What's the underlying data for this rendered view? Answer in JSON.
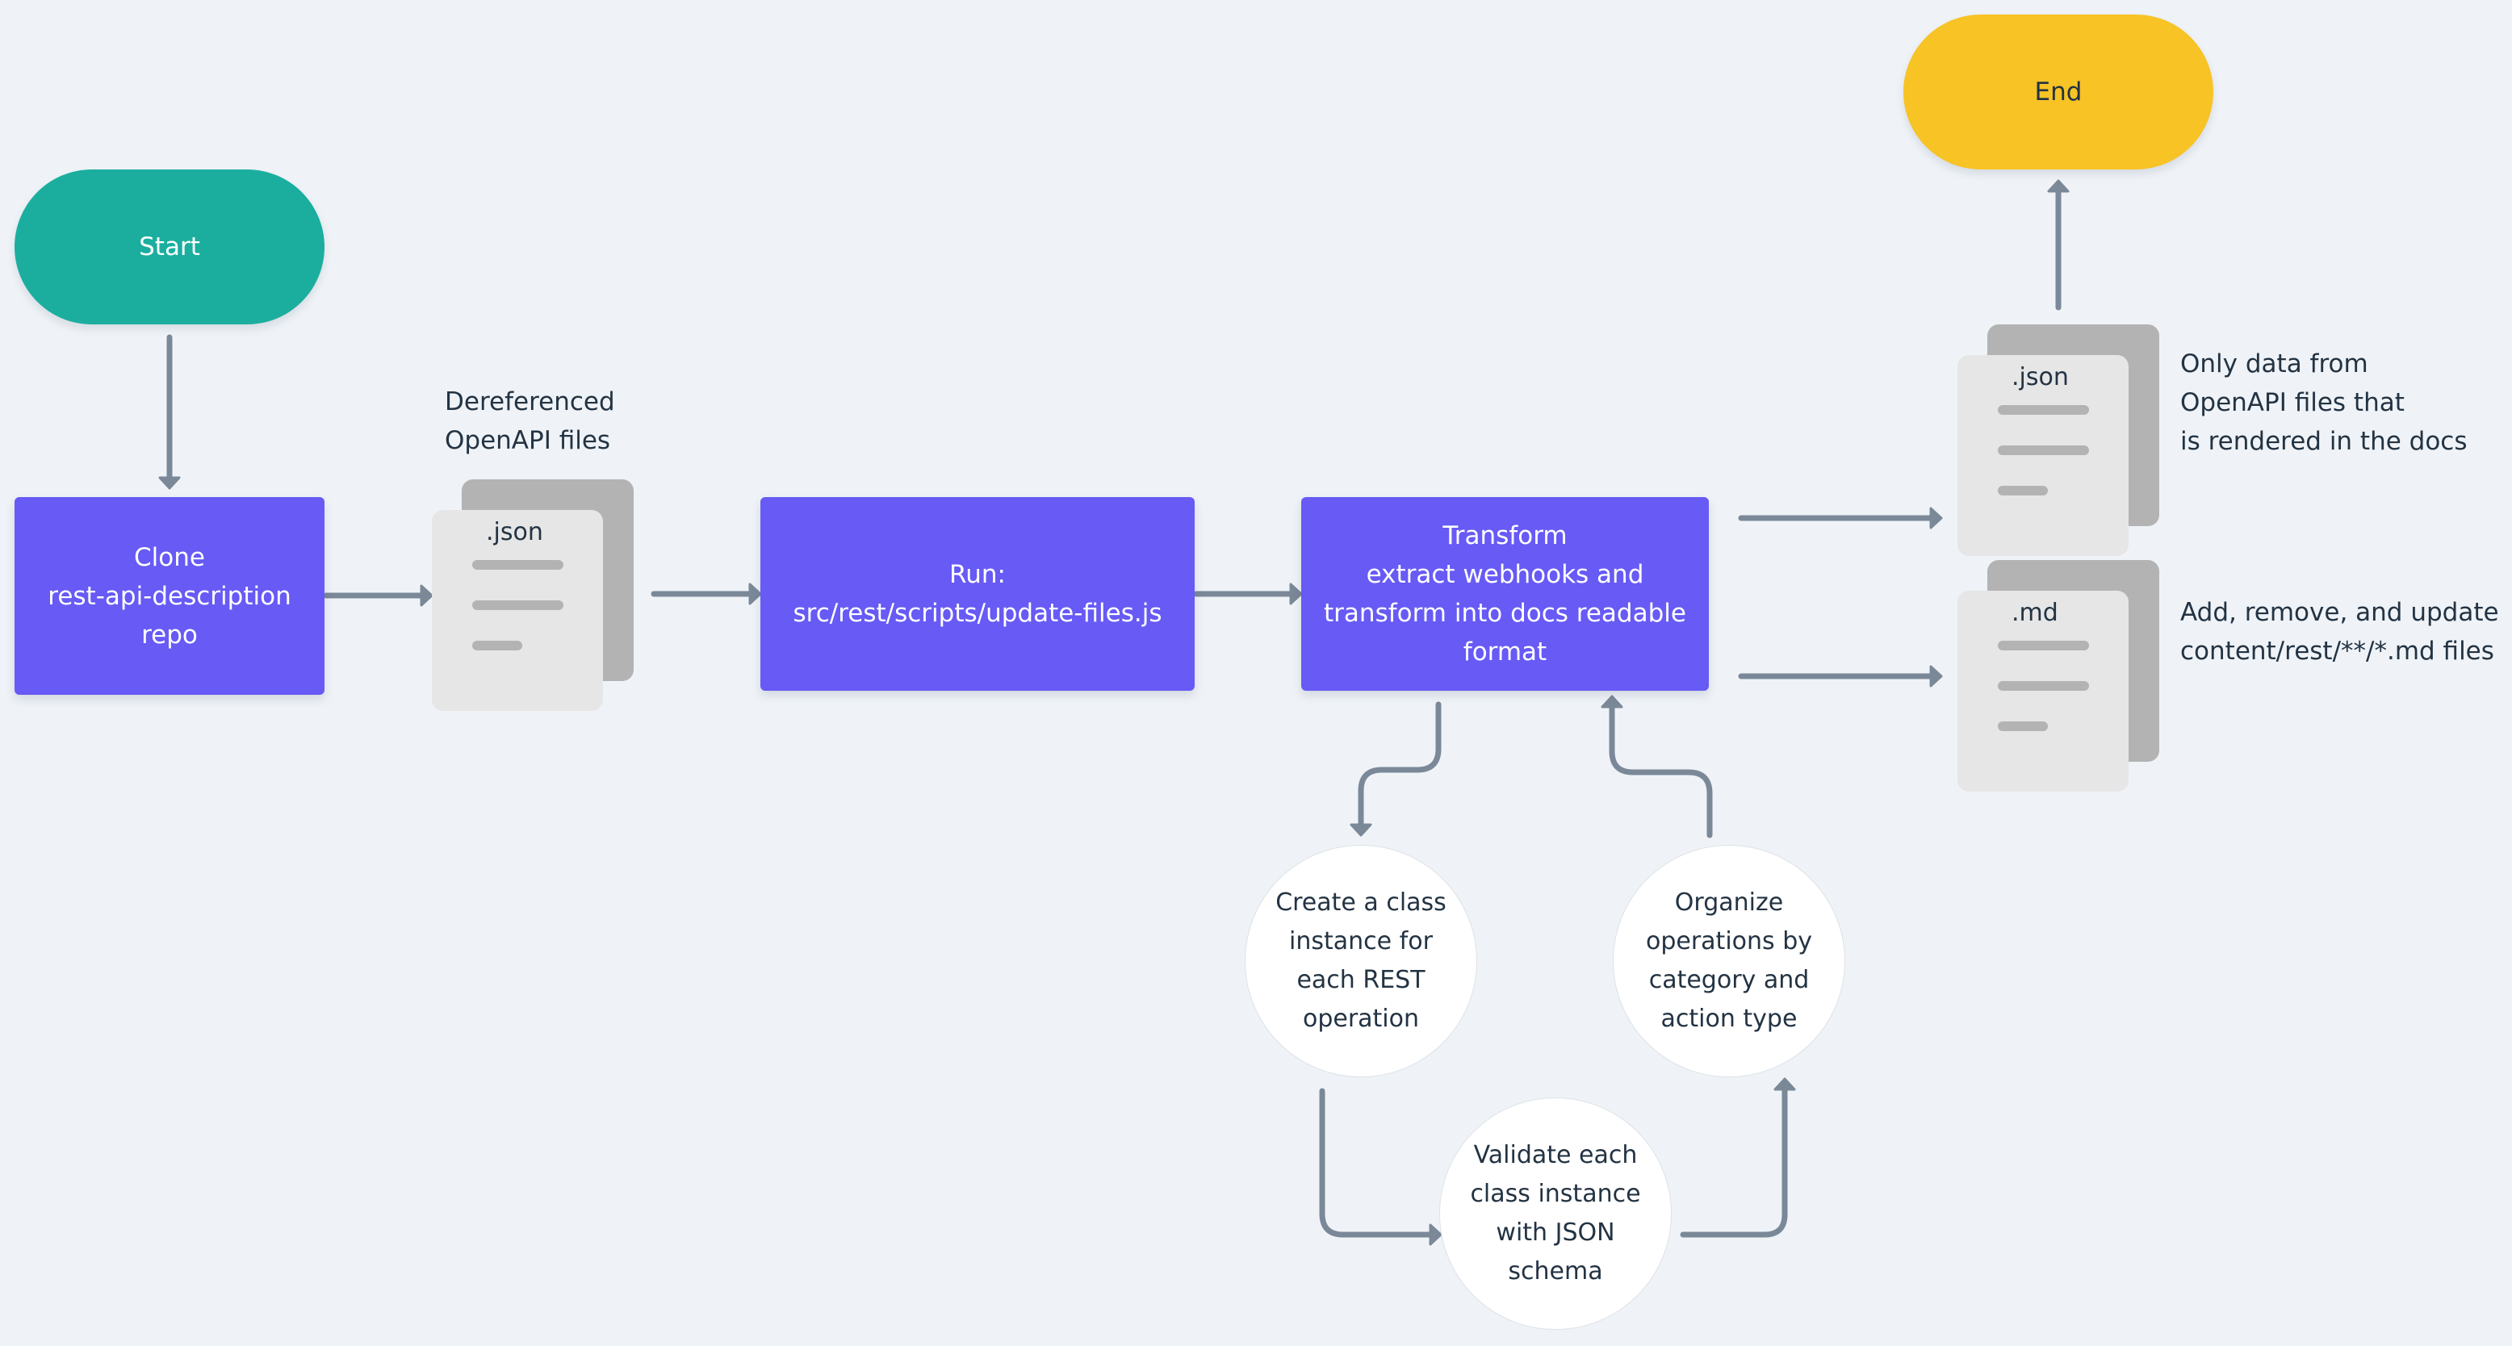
{
  "diagram": {
    "nodes": {
      "start": {
        "label": "Start",
        "shape": "terminal",
        "color": "#1bae9f"
      },
      "end": {
        "label": "End",
        "shape": "terminal",
        "color": "#f7c325"
      },
      "clone": {
        "label": "Clone\nrest-api-description\nrepo",
        "shape": "process",
        "color": "#675af5"
      },
      "run": {
        "label": "Run:\nsrc/rest/scripts/update-files.js",
        "shape": "process",
        "color": "#675af5"
      },
      "transform": {
        "label": "Transform\nextract webhooks and\ntransform into docs readable\nformat",
        "shape": "process",
        "color": "#675af5"
      },
      "create": {
        "label": "Create a class\ninstance for\neach REST\noperation",
        "shape": "circle"
      },
      "validate": {
        "label": "Validate each\nclass instance\nwith JSON\nschema",
        "shape": "circle"
      },
      "organize": {
        "label": "Organize\noperations by\ncategory and\naction type",
        "shape": "circle"
      }
    },
    "documents": {
      "dereferenced": {
        "extension": ".json",
        "caption": "Dereferenced\nOpenAPI files"
      },
      "output_json": {
        "extension": ".json",
        "caption": "Only data from\nOpenAPI files that\nis rendered in the docs"
      },
      "output_md": {
        "extension": ".md",
        "caption": "Add, remove, and update\ncontent/rest/**/*.md files"
      }
    },
    "edges": [
      {
        "from": "start",
        "to": "clone"
      },
      {
        "from": "clone",
        "to": "dereferenced"
      },
      {
        "from": "dereferenced",
        "to": "run"
      },
      {
        "from": "run",
        "to": "transform"
      },
      {
        "from": "transform",
        "to": "create"
      },
      {
        "from": "create",
        "to": "validate"
      },
      {
        "from": "validate",
        "to": "organize"
      },
      {
        "from": "organize",
        "to": "transform"
      },
      {
        "from": "transform",
        "to": "output_json"
      },
      {
        "from": "transform",
        "to": "output_md"
      },
      {
        "from": "output_json",
        "to": "end"
      }
    ],
    "colors": {
      "background": "#eff3f7",
      "connector": "#7a8898",
      "text": "#233343",
      "doc_front": "#e6e6e6",
      "doc_back": "#b3b3b3"
    }
  }
}
